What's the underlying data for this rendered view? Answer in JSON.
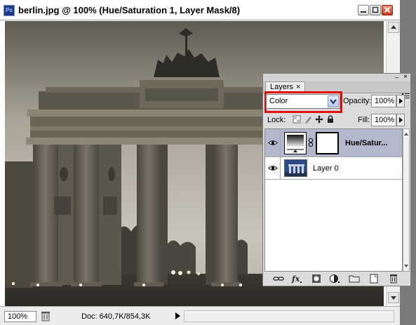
{
  "document": {
    "app_badge": "Ps",
    "title": "berlin.jpg @ 100% (Hue/Saturation 1, Layer Mask/8)",
    "zoom": "100%",
    "doc_info": "Doc: 640,7K/854,3K"
  },
  "layers_panel": {
    "tab_label": "Layers",
    "tab_close": "×",
    "minimize_glyph": "–",
    "close_glyph": "×",
    "blend_mode": "Color",
    "opacity_label": "Opacity:",
    "opacity_value": "100%",
    "lock_label": "Lock:",
    "fill_label": "Fill:",
    "fill_value": "100%",
    "layers": [
      {
        "name": "Hue/Satur...",
        "type": "adjustment",
        "visible": true,
        "selected": true
      },
      {
        "name": "Layer 0",
        "type": "image",
        "visible": true,
        "selected": false
      }
    ],
    "footer_icons": [
      "link-icon",
      "fx-icon",
      "add-mask-icon",
      "new-adjustment-icon",
      "new-group-icon",
      "new-layer-icon",
      "delete-layer-icon"
    ]
  },
  "colors": {
    "highlight_border": "#e01010",
    "selected_row": "#b4b8cc",
    "panel_bg": "#dcdcdc"
  }
}
